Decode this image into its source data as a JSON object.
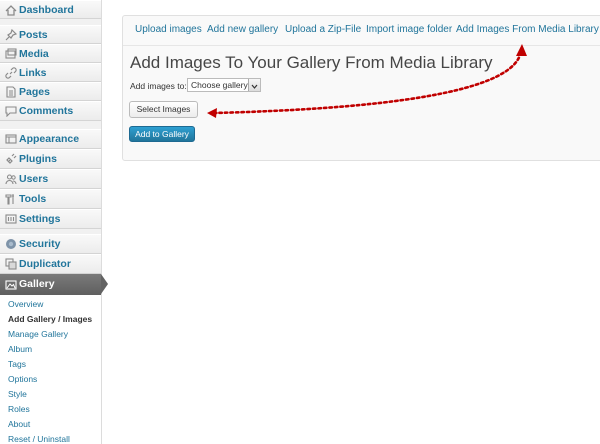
{
  "sidebar": {
    "items": [
      {
        "label": "Dashboard",
        "icon": "dashboard-icon"
      },
      {
        "label": "Posts",
        "icon": "pushpin-icon"
      },
      {
        "label": "Media",
        "icon": "media-icon"
      },
      {
        "label": "Links",
        "icon": "link-icon"
      },
      {
        "label": "Pages",
        "icon": "page-icon"
      },
      {
        "label": "Comments",
        "icon": "comment-icon"
      },
      {
        "label": "Appearance",
        "icon": "appearance-icon"
      },
      {
        "label": "Plugins",
        "icon": "plugin-icon"
      },
      {
        "label": "Users",
        "icon": "users-icon"
      },
      {
        "label": "Tools",
        "icon": "tools-icon"
      },
      {
        "label": "Settings",
        "icon": "settings-icon"
      },
      {
        "label": "Security",
        "icon": "security-icon"
      },
      {
        "label": "Duplicator",
        "icon": "duplicator-icon"
      }
    ],
    "active": {
      "label": "Gallery",
      "icon": "gallery-icon"
    },
    "submenu": [
      {
        "label": "Overview"
      },
      {
        "label": "Add Gallery / Images",
        "current": true
      },
      {
        "label": "Manage Gallery"
      },
      {
        "label": "Album"
      },
      {
        "label": "Tags"
      },
      {
        "label": "Options"
      },
      {
        "label": "Style"
      },
      {
        "label": "Roles"
      },
      {
        "label": "About"
      },
      {
        "label": "Reset / Uninstall"
      }
    ]
  },
  "tabs": [
    {
      "label": "Upload images"
    },
    {
      "label": "Add new gallery"
    },
    {
      "label": "Upload a Zip-File"
    },
    {
      "label": "Import image folder"
    },
    {
      "label": "Add Images From Media Library"
    }
  ],
  "main": {
    "title": "Add Images To Your Gallery From Media Library",
    "add_images_to_label": "Add images to:",
    "gallery_select_value": "Choose gallery",
    "select_images_button": "Select Images",
    "add_to_gallery_button": "Add to Gallery"
  },
  "colors": {
    "link": "#21759b",
    "active_menu": "#636363",
    "primary_button": "#21759b",
    "annotation_arrow": "#c00000"
  }
}
